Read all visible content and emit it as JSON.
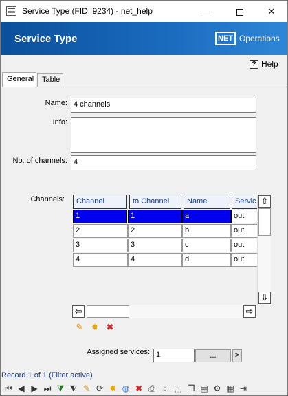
{
  "window": {
    "title": "Service Type (FID: 9234) - net_help",
    "min_glyph": "—",
    "close_glyph": "✕"
  },
  "banner": {
    "heading": "Service Type",
    "logo_box": "NET",
    "logo_text": "Operations"
  },
  "help": {
    "label": "Help",
    "icon_glyph": "?"
  },
  "tabs": [
    {
      "label": "General",
      "active": true
    },
    {
      "label": "Table",
      "active": false
    }
  ],
  "form": {
    "name_label": "Name:",
    "name_value": "4 channels",
    "info_label": "Info:",
    "info_value": "",
    "channels_count_label": "No. of channels:",
    "channels_count_value": "4",
    "channels_label": "Channels:",
    "assigned_label": "Assigned services:",
    "assigned_value": "1",
    "assigned_more": "...",
    "assigned_go": ">"
  },
  "grid": {
    "columns": [
      "Channel",
      "to Channel",
      "Name",
      "Servic"
    ],
    "rows": [
      [
        "1",
        "1",
        "a",
        "out"
      ],
      [
        "2",
        "2",
        "b",
        "out"
      ],
      [
        "3",
        "3",
        "c",
        "out"
      ],
      [
        "4",
        "4",
        "d",
        "out"
      ]
    ],
    "selected_row": 0,
    "scroll_glyphs": {
      "up": "⇧",
      "down": "⇩",
      "left": "⇦",
      "right": "⇨"
    },
    "tools": [
      {
        "name": "edit-icon",
        "glyph": "✎",
        "color": "#d98c1a"
      },
      {
        "name": "new-icon",
        "glyph": "✸",
        "color": "#e7a300"
      },
      {
        "name": "delete-icon",
        "glyph": "✖",
        "color": "#d42020"
      }
    ]
  },
  "status": {
    "text": "Record 1 of 1 (Filter active)"
  },
  "toolbar": [
    {
      "name": "first-record-icon",
      "glyph": "⏮"
    },
    {
      "name": "prev-record-icon",
      "glyph": "◀"
    },
    {
      "name": "next-record-icon",
      "glyph": "▶"
    },
    {
      "name": "last-record-icon",
      "glyph": "⏭"
    },
    {
      "name": "add-filter-icon",
      "glyph": "⧩"
    },
    {
      "name": "filter-icon",
      "glyph": "⧨"
    },
    {
      "name": "edit-icon",
      "glyph": "✎"
    },
    {
      "name": "refresh-icon",
      "glyph": "⟳"
    },
    {
      "name": "new-icon",
      "glyph": "✸"
    },
    {
      "name": "globe-icon",
      "glyph": "◍"
    },
    {
      "name": "delete-icon",
      "glyph": "✖"
    },
    {
      "name": "print-icon",
      "glyph": "⎙"
    },
    {
      "name": "zoom-icon",
      "glyph": "⌕"
    },
    {
      "name": "select-icon",
      "glyph": "⬚"
    },
    {
      "name": "copy-icon",
      "glyph": "❐"
    },
    {
      "name": "chart-icon",
      "glyph": "▤"
    },
    {
      "name": "tools-icon",
      "glyph": "⚙"
    },
    {
      "name": "table-icon",
      "glyph": "▦"
    },
    {
      "name": "exit-icon",
      "glyph": "⇥"
    }
  ],
  "colors": {
    "banner_start": "#0a4f9a",
    "banner_end": "#2f86d6",
    "selection": "#0000ee",
    "header_text": "#1a3a8a"
  }
}
